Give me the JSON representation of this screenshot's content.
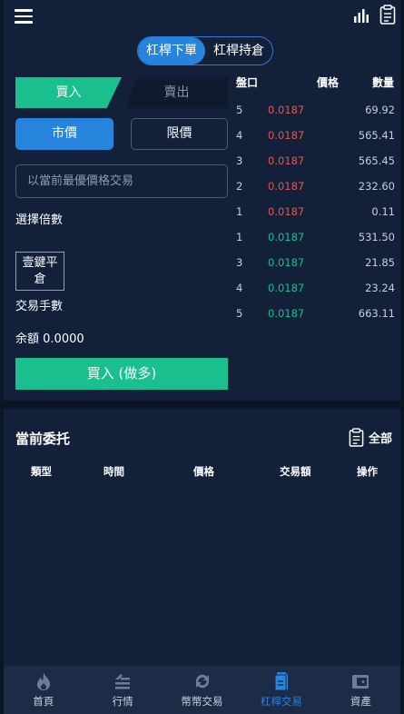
{
  "header": {
    "segment": [
      {
        "label": "杠桿下單",
        "active": true
      },
      {
        "label": "杠桿持倉",
        "active": false
      }
    ],
    "icons": [
      "menu-icon",
      "bar-chart-icon",
      "clipboard-icon"
    ]
  },
  "form": {
    "buy_tab": "買入",
    "sell_tab": "賣出",
    "market_label": "市價",
    "limit_label": "限價",
    "price_placeholder": "以當前最優價格交易",
    "leverage_label": "選擇倍數",
    "close_all_label": "壹鍵平倉",
    "lots_label": "交易手數",
    "balance_label": "余額",
    "balance_value": "0.0000",
    "submit_label": "買入 (做多)"
  },
  "orderbook": {
    "headers": {
      "level": "盤口",
      "price": "價格",
      "qty": "數量"
    },
    "asks": [
      {
        "level": "5",
        "price": "0.0187",
        "qty": "69.92"
      },
      {
        "level": "4",
        "price": "0.0187",
        "qty": "565.41"
      },
      {
        "level": "3",
        "price": "0.0187",
        "qty": "565.45"
      },
      {
        "level": "2",
        "price": "0.0187",
        "qty": "232.60"
      },
      {
        "level": "1",
        "price": "0.0187",
        "qty": "0.11"
      }
    ],
    "bids": [
      {
        "level": "1",
        "price": "0.0187",
        "qty": "531.50"
      },
      {
        "level": "3",
        "price": "0.0187",
        "qty": "21.85"
      },
      {
        "level": "4",
        "price": "0.0187",
        "qty": "23.24"
      },
      {
        "level": "5",
        "price": "0.0187",
        "qty": "663.11"
      }
    ],
    "ask_color": "#e4584e",
    "bid_color": "#19c08e"
  },
  "orders": {
    "title": "當前委托",
    "all_label": "全部",
    "columns": [
      "類型",
      "時間",
      "價格",
      "交易額",
      "操作"
    ]
  },
  "tabbar": {
    "items": [
      {
        "label": "首頁",
        "icon": "flame-icon",
        "active": false
      },
      {
        "label": "行情",
        "icon": "market-icon",
        "active": false
      },
      {
        "label": "幣幣交易",
        "icon": "refresh-icon",
        "active": false
      },
      {
        "label": "杠桿交易",
        "icon": "document-icon",
        "active": true
      },
      {
        "label": "資產",
        "icon": "wallet-icon",
        "active": false
      }
    ]
  },
  "colors": {
    "accent": "#2784dc",
    "buy": "#19c08e",
    "background": "#12203a"
  }
}
